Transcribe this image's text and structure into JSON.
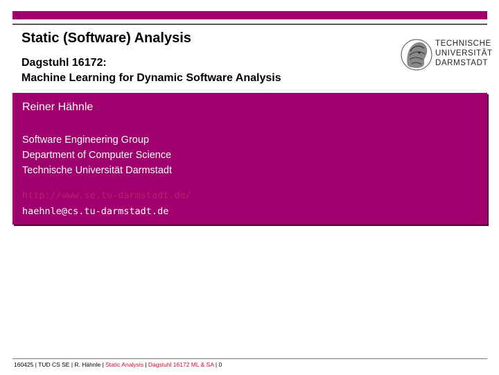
{
  "header": {
    "title": "Static (Software) Analysis",
    "subtitle_line1": "Dagstuhl 16172:",
    "subtitle_line2": "Machine Learning for Dynamic Software Analysis"
  },
  "logo": {
    "line1": "TECHNISCHE",
    "line2": "UNIVERSITÄT",
    "line3": "DARMSTADT"
  },
  "author": {
    "name": "Reiner Hähnle",
    "affiliation": [
      "Software Engineering Group",
      "Department of Computer Science",
      "Technische Universität Darmstadt"
    ],
    "url": "http://www.se.tu-darmstadt.de/",
    "email": "haehnle@cs.tu-darmstadt.de"
  },
  "footer": {
    "part1": "160425 | TUD CS SE | R. Hähnle | ",
    "part2": "Static Analysis",
    "sep1": " | ",
    "part3": "Dagstuhl 16172 ML & SA",
    "sep2": " | ",
    "page": "0"
  },
  "colors": {
    "accent": "#a0006e",
    "link": "#c01c6e",
    "footer_highlight": "#c8102e"
  }
}
